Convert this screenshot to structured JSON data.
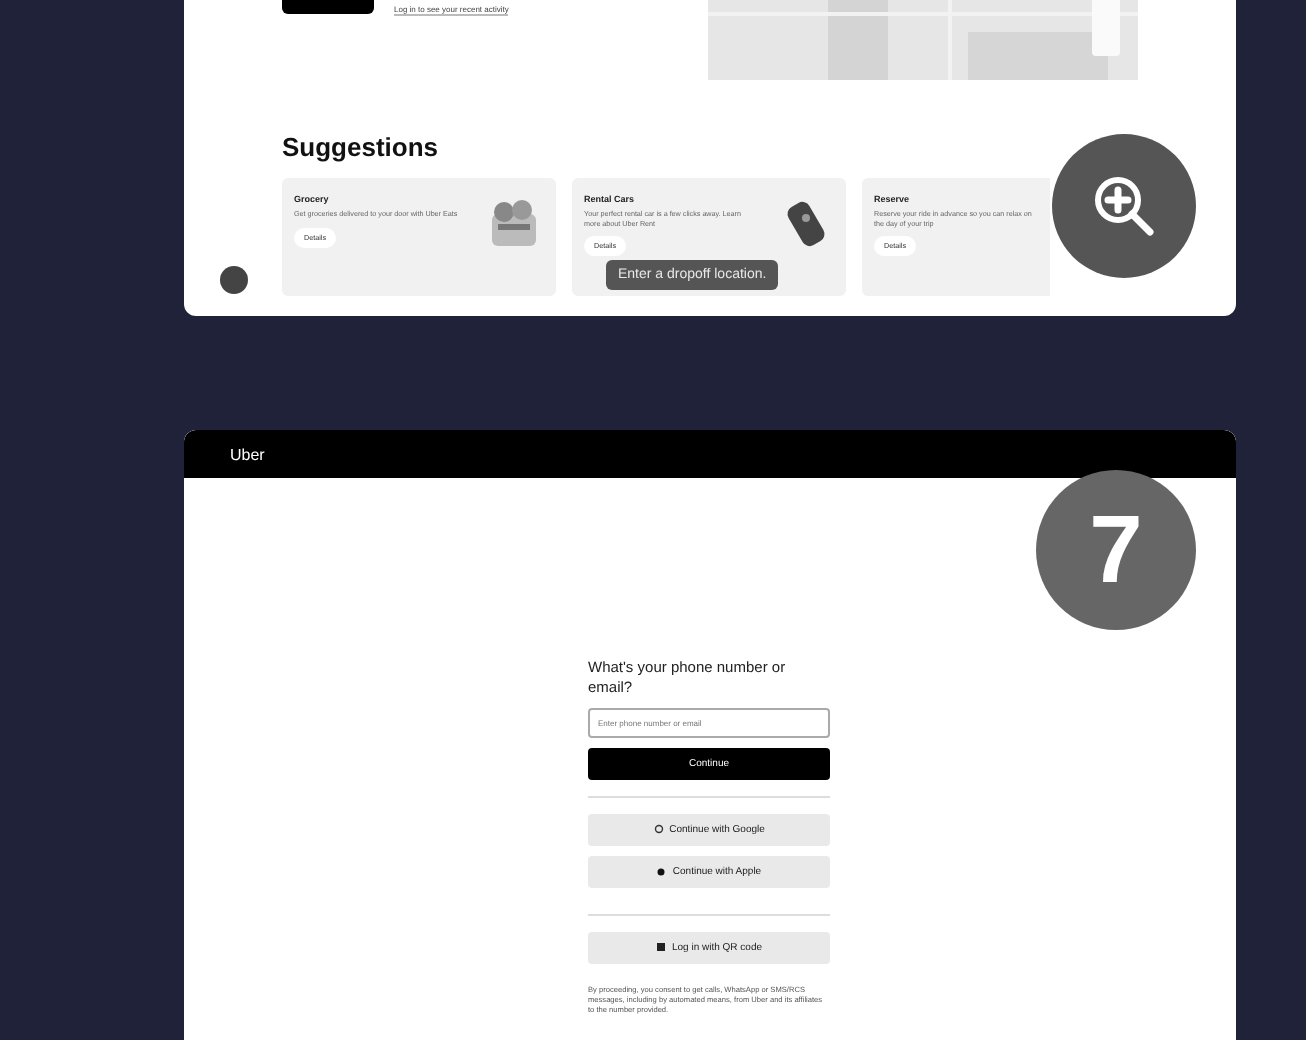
{
  "top_card": {
    "link": "Log in to see your recent activity",
    "suggestions_title": "Suggestions",
    "suggestions": [
      {
        "title": "Grocery",
        "text": "Get groceries delivered to your door with Uber Eats",
        "button": "Details"
      },
      {
        "title": "Rental Cars",
        "text": "Your perfect rental car is a few clicks away. Learn more about Uber Rent",
        "button": "Details"
      },
      {
        "title": "Reserve",
        "text": "Reserve your ride in advance so you can relax on the day of your trip",
        "button": "Details"
      }
    ],
    "tooltip": "Enter a dropoff location."
  },
  "second_card": {
    "header": "Uber",
    "number": "7",
    "question": "What's your phone number or email?",
    "placeholder": "Enter phone number or email",
    "continue": "Continue",
    "google": "Continue with Google",
    "apple": "Continue with Apple",
    "qr": "Log in with QR code",
    "fine_print": "By proceeding, you consent to get calls, WhatsApp or SMS/RCS messages, including by automated means, from Uber and its affiliates to the number provided."
  }
}
